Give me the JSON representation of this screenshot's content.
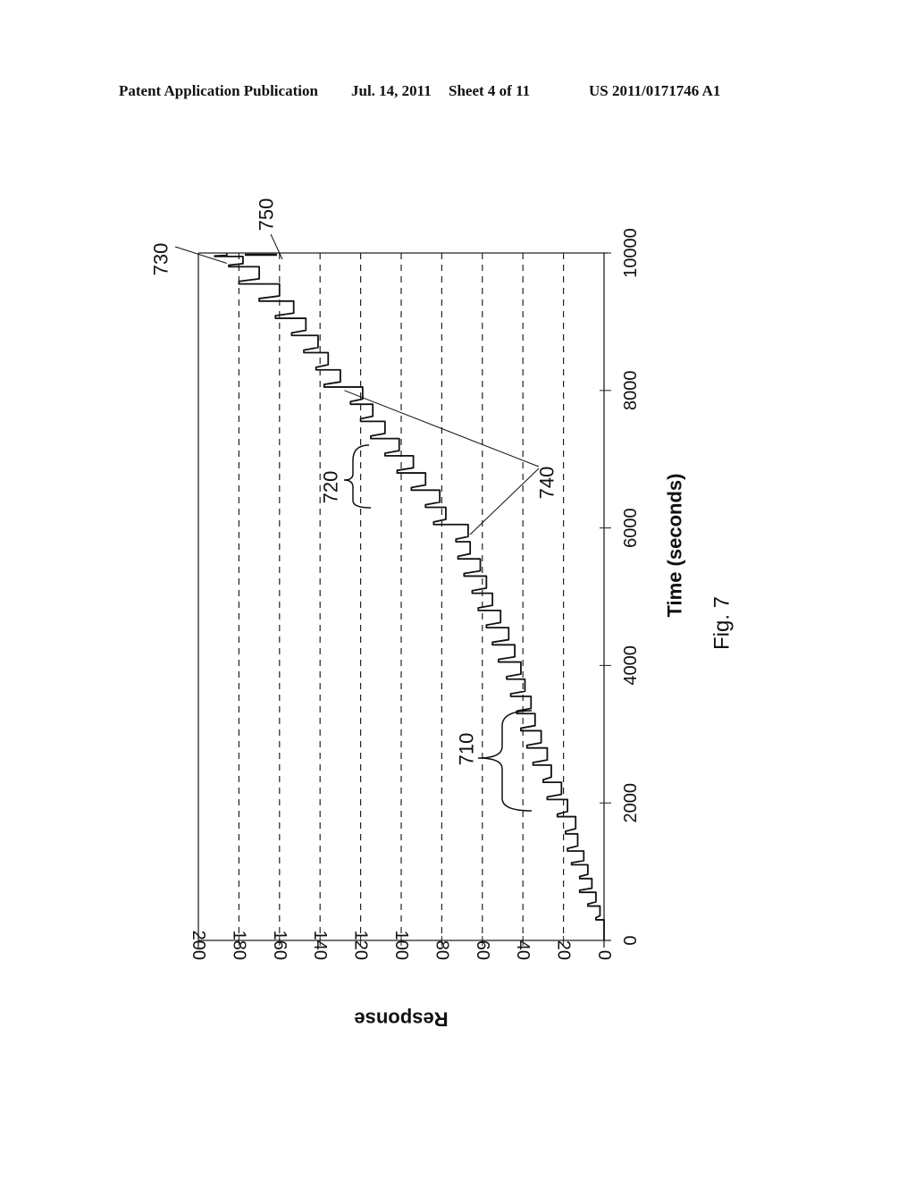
{
  "header": {
    "publication": "Patent Application Publication",
    "date": "Jul. 14, 2011",
    "sheet": "Sheet 4 of 11",
    "patent_number": "US 2011/0171746 A1"
  },
  "figure_label": "Fig. 7",
  "annotations": [
    {
      "id": "730",
      "label": "730",
      "target_time": 9850,
      "target_response": 186
    },
    {
      "id": "750",
      "label": "750",
      "target_time": 9980,
      "target_response": 160
    },
    {
      "id": "720",
      "label": "720",
      "brace_time_range": [
        6200,
        7200
      ],
      "brace_response": 122
    },
    {
      "id": "740",
      "label": "740",
      "targets": [
        {
          "time": 8000,
          "response": 128
        },
        {
          "time": 5900,
          "response": 66
        }
      ]
    },
    {
      "id": "710",
      "label": "710",
      "brace_time_range": [
        1800,
        3400
      ],
      "brace_response": 38
    }
  ],
  "chart_data": {
    "type": "line",
    "title": "",
    "xlabel": "Time (seconds)",
    "ylabel": "Response",
    "xlim": [
      0,
      10000
    ],
    "ylim": [
      0,
      200
    ],
    "x_ticks": [
      "0",
      "2000",
      "4000",
      "6000",
      "8000",
      "10000"
    ],
    "x_tick_values": [
      0,
      2000,
      4000,
      6000,
      8000,
      10000
    ],
    "y_ticks": [
      "0",
      "20",
      "40",
      "60",
      "80",
      "100",
      "120",
      "140",
      "160",
      "180",
      "200"
    ],
    "y_tick_values": [
      0,
      20,
      40,
      60,
      80,
      100,
      120,
      140,
      160,
      180,
      200
    ],
    "grid": "dashed horizontal at each y tick",
    "orientation": "rotated 90 degrees clockwise",
    "series": [
      {
        "name": "response",
        "steps": [
          {
            "t": 300,
            "high": 4,
            "low": 2
          },
          {
            "t": 500,
            "high": 8,
            "low": 4
          },
          {
            "t": 700,
            "high": 12,
            "low": 6
          },
          {
            "t": 900,
            "high": 12,
            "low": 8
          },
          {
            "t": 1100,
            "high": 16,
            "low": 10
          },
          {
            "t": 1300,
            "high": 18,
            "low": 13
          },
          {
            "t": 1550,
            "high": 19,
            "low": 14
          },
          {
            "t": 1800,
            "high": 23,
            "low": 18
          },
          {
            "t": 2050,
            "high": 28,
            "low": 21
          },
          {
            "t": 2300,
            "high": 30,
            "low": 26
          },
          {
            "t": 2550,
            "high": 35,
            "low": 28
          },
          {
            "t": 2800,
            "high": 38,
            "low": 31
          },
          {
            "t": 3050,
            "high": 41,
            "low": 34
          },
          {
            "t": 3300,
            "high": 43,
            "low": 36
          },
          {
            "t": 3550,
            "high": 46,
            "low": 39
          },
          {
            "t": 3800,
            "high": 48,
            "low": 41
          },
          {
            "t": 4050,
            "high": 52,
            "low": 44
          },
          {
            "t": 4300,
            "high": 55,
            "low": 47
          },
          {
            "t": 4550,
            "high": 58,
            "low": 51
          },
          {
            "t": 4800,
            "high": 62,
            "low": 55
          },
          {
            "t": 5050,
            "high": 65,
            "low": 58
          },
          {
            "t": 5300,
            "high": 69,
            "low": 61
          },
          {
            "t": 5550,
            "high": 72,
            "low": 66
          },
          {
            "t": 5800,
            "high": 73,
            "low": 67
          },
          {
            "t": 6050,
            "high": 84,
            "low": 78
          },
          {
            "t": 6300,
            "high": 88,
            "low": 81
          },
          {
            "t": 6550,
            "high": 95,
            "low": 88
          },
          {
            "t": 6800,
            "high": 102,
            "low": 94
          },
          {
            "t": 7050,
            "high": 108,
            "low": 101
          },
          {
            "t": 7300,
            "high": 115,
            "low": 108
          },
          {
            "t": 7550,
            "high": 120,
            "low": 114
          },
          {
            "t": 7800,
            "high": 125,
            "low": 119
          },
          {
            "t": 8050,
            "high": 138,
            "low": 130
          },
          {
            "t": 8300,
            "high": 142,
            "low": 136
          },
          {
            "t": 8550,
            "high": 148,
            "low": 141
          },
          {
            "t": 8800,
            "high": 154,
            "low": 147
          },
          {
            "t": 9050,
            "high": 162,
            "low": 153
          },
          {
            "t": 9300,
            "high": 170,
            "low": 160
          },
          {
            "t": 9550,
            "high": 180,
            "low": 170
          },
          {
            "t": 9800,
            "high": 185,
            "low": 178
          },
          {
            "t": 9950,
            "high": 192,
            "low": 186
          }
        ]
      }
    ]
  }
}
